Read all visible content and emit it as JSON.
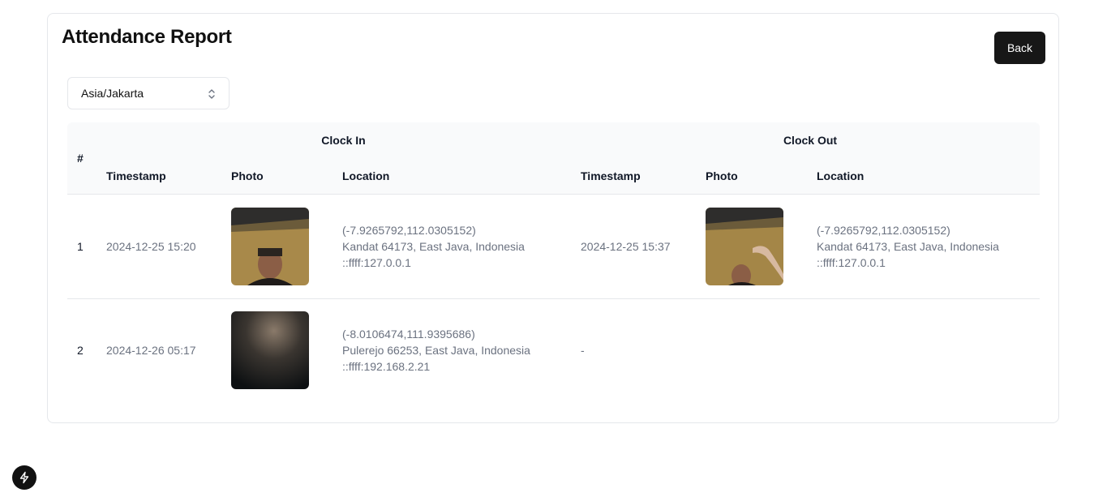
{
  "page": {
    "title": "Attendance Report"
  },
  "toolbar": {
    "back_label": "Back"
  },
  "timezone": {
    "selected": "Asia/Jakarta",
    "icon": "chevron-up-down-icon"
  },
  "table": {
    "hash_header": "#",
    "group_headers": {
      "clock_in": "Clock In",
      "clock_out": "Clock Out"
    },
    "columns": {
      "in_timestamp": "Timestamp",
      "in_photo": "Photo",
      "in_location": "Location",
      "out_timestamp": "Timestamp",
      "out_photo": "Photo",
      "out_location": "Location"
    },
    "rows": [
      {
        "num": "1",
        "in_timestamp": "2024-12-25 15:20",
        "in_coords": "(-7.9265792,112.0305152)",
        "in_place": "Kandat 64173, East Java, Indonesia",
        "in_ip": "::ffff:127.0.0.1",
        "out_timestamp": "2024-12-25 15:37",
        "out_coords": "(-7.9265792,112.0305152)",
        "out_place": "Kandat 64173, East Java, Indonesia",
        "out_ip": "::ffff:127.0.0.1"
      },
      {
        "num": "2",
        "in_timestamp": "2024-12-26 05:17",
        "in_coords": "(-8.0106474,111.9395686)",
        "in_place": "Pulerejo 66253, East Java, Indonesia",
        "in_ip": "::ffff:192.168.2.21",
        "out_timestamp": "-"
      }
    ]
  },
  "dev_tools": {
    "icon": "lightning-bolt-icon"
  }
}
